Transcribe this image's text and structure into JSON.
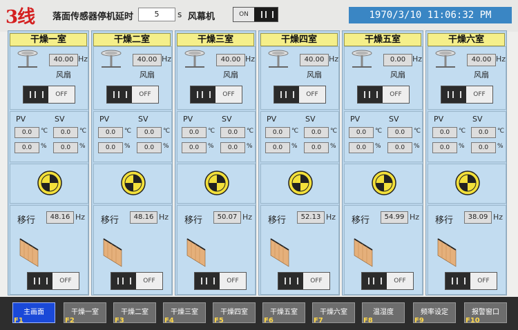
{
  "header": {
    "line_title": "3线",
    "delay_label": "落面传感器停机延时",
    "delay_value": "5",
    "delay_unit": "s",
    "fan_label": "风幕机",
    "fan_toggle_label": "ON",
    "datetime": "1970/3/10  11:06:32 PM"
  },
  "colors": {
    "title_red": "#d42020",
    "datetime_bg": "#3a86c4",
    "panel_bg": "#b9d4ea",
    "title_yellow": "#f5ef8a",
    "active_key": "#1a49d8",
    "belt": "#e5b07b"
  },
  "labels": {
    "fan": "风扇",
    "pv": "PV",
    "sv": "SV",
    "celsius": "℃",
    "percent": "%",
    "move": "移行",
    "hz": "Hz",
    "off": "OFF"
  },
  "rooms": [
    {
      "title": "干燥一室",
      "fan_hz": "40.00",
      "pv_temp": "0.0",
      "sv_temp": "0.0",
      "pv_hum": "0.0",
      "sv_hum": "0.0",
      "move_hz": "48.16"
    },
    {
      "title": "干燥二室",
      "fan_hz": "40.00",
      "pv_temp": "0.0",
      "sv_temp": "0.0",
      "pv_hum": "0.0",
      "sv_hum": "0.0",
      "move_hz": "48.16"
    },
    {
      "title": "干燥三室",
      "fan_hz": "40.00",
      "pv_temp": "0.0",
      "sv_temp": "0.0",
      "pv_hum": "0.0",
      "sv_hum": "0.0",
      "move_hz": "50.07"
    },
    {
      "title": "干燥四室",
      "fan_hz": "40.00",
      "pv_temp": "0.0",
      "sv_temp": "0.0",
      "pv_hum": "0.0",
      "sv_hum": "0.0",
      "move_hz": "52.13"
    },
    {
      "title": "干燥五室",
      "fan_hz": "0.00",
      "pv_temp": "0.0",
      "sv_temp": "0.0",
      "pv_hum": "0.0",
      "sv_hum": "0.0",
      "move_hz": "54.99"
    },
    {
      "title": "干燥六室",
      "fan_hz": "40.00",
      "pv_temp": "0.0",
      "sv_temp": "0.0",
      "pv_hum": "0.0",
      "sv_hum": "0.0",
      "move_hz": "38.09"
    }
  ],
  "function_keys": [
    {
      "label": "主画面",
      "num": "F1",
      "active": true
    },
    {
      "label": "干燥一室",
      "num": "F2"
    },
    {
      "label": "干燥二室",
      "num": "F3"
    },
    {
      "label": "干燥三室",
      "num": "F4"
    },
    {
      "label": "干燥四室",
      "num": "F5"
    },
    {
      "label": "干燥五室",
      "num": "F6"
    },
    {
      "label": "干燥六室",
      "num": "F7"
    },
    {
      "label": "温湿度",
      "num": "F8"
    },
    {
      "label": "频率设定",
      "num": "F9"
    },
    {
      "label": "报警窗口",
      "num": "F10"
    }
  ]
}
